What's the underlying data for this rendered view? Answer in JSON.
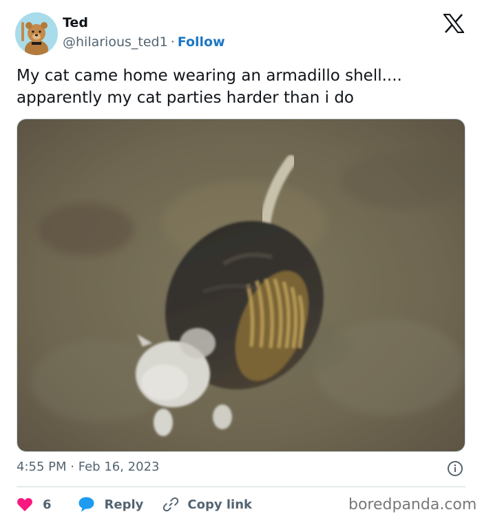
{
  "user": {
    "name": "Ted",
    "handle": "@hilarious_ted1",
    "separator": "·",
    "follow_label": "Follow"
  },
  "tweet": {
    "text_line1": "My cat came home wearing an armadillo shell....",
    "text_line2": "apparently my cat parties harder than i do",
    "time": "4:55 PM",
    "separator": "·",
    "date": "Feb 16, 2023"
  },
  "actions": {
    "like_count": "6",
    "reply_label": "Reply",
    "copy_label": "Copy link"
  },
  "watermark": "boredpanda.com",
  "icons": {
    "logo": "x-logo-icon",
    "info": "info-icon",
    "like": "heart-icon",
    "reply": "speech-bubble-icon",
    "copy": "link-icon"
  },
  "colors": {
    "text": "#0f1419",
    "secondary": "#536471",
    "follow": "#1d77c3",
    "like": "#f91880",
    "reply": "#1d9bf0",
    "divider": "#cfd9de"
  }
}
